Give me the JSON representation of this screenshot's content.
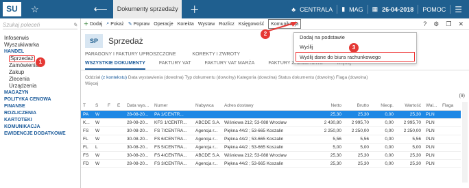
{
  "topbar": {
    "logo": "SU",
    "tab_title": "Dokumenty sprzedaży",
    "centrala": "CENTRALA",
    "mag": "MAG",
    "date": "26-04-2018",
    "pomoc": "POMOC"
  },
  "sidebar": {
    "search_placeholder": "Szukaj poleceń",
    "items": [
      {
        "label": "Infoserwis",
        "kind": "item"
      },
      {
        "label": "Wyszukiwarka",
        "kind": "item"
      },
      {
        "label": "HANDEL",
        "kind": "head"
      },
      {
        "label": "Sprzedaż",
        "kind": "active"
      },
      {
        "label": "Zamówienia",
        "kind": "sub"
      },
      {
        "label": "Zakup",
        "kind": "sub"
      },
      {
        "label": "Zlecenia",
        "kind": "sub"
      },
      {
        "label": "Urządzenia",
        "kind": "sub"
      },
      {
        "label": "MAGAZYN",
        "kind": "head"
      },
      {
        "label": "POLITYKA CENOWA",
        "kind": "head"
      },
      {
        "label": "FINANSE",
        "kind": "head"
      },
      {
        "label": "ROZLICZENIA",
        "kind": "head"
      },
      {
        "label": "KARTOTEKI",
        "kind": "head"
      },
      {
        "label": "KOMUNIKACJA",
        "kind": "head"
      },
      {
        "label": "EWIDENCJE DODATKOWE",
        "kind": "head"
      }
    ]
  },
  "toolbar": {
    "dodaj": "Dodaj",
    "pokaz": "Pokaż",
    "popraw": "Popraw",
    "operacje": "Operacje",
    "korekta": "Korekta",
    "wystaw": "Wystaw",
    "rozlicz": "Rozlicz",
    "ksiegowosc": "Księgowość",
    "komunikacja": "Komunikacja"
  },
  "page": {
    "badge": "SP",
    "title": "Sprzedaż"
  },
  "tabs_row1": [
    "PARAGONY I FAKTURY UPROSZCZONE",
    "KOREKTY I ZWROTY"
  ],
  "tabs_row2": [
    "WSZYSTKIE DOKUMENTY",
    "FAKTURY VAT",
    "FAKTURY VAT MARŻA",
    "FAKTURY ZALICZKOWE",
    "Więcej"
  ],
  "filters": {
    "oddzial": "Oddział",
    "oddzial_val": "(z kontekstu)",
    "rest": "Data wystawienia (dowolna)   Typ dokumentu (dowolny)   Kategoria (dowolna)   Status dokumentu (dowolny)   Flaga (dowolna)",
    "wiecej": "Więcej",
    "count": "(9)"
  },
  "table": {
    "headers": [
      "T",
      "S",
      "F",
      "E",
      "Data wys...",
      "Numer",
      "Nabywca",
      "Adres dostawy",
      "Netto",
      "Brutto",
      "Nieop.",
      "Wartość",
      "Wal...",
      "Flaga"
    ],
    "rows": [
      [
        "PA",
        "W",
        "",
        "",
        "28-08-20...",
        "PA 1/CENTR...",
        "",
        "",
        "25,30",
        "25,30",
        "0,00",
        "25,30",
        "PLN",
        ""
      ],
      [
        "K...",
        "W",
        "",
        "",
        "28-08-20...",
        "KFS 1/CENTR...",
        "ABCDE S.A.",
        "Wiśniowa 212; 53-088 Wrocław",
        "2 430,80",
        "2 995,70",
        "0,00",
        "2 995,70",
        "PLN",
        ""
      ],
      [
        "FS",
        "W",
        "",
        "",
        "30-08-20...",
        "FS 7/CENTRA...",
        "Agencja r...",
        "Piękna  44/2 ; 53-665 Koszalin",
        "2 250,00",
        "2 250,00",
        "0,00",
        "2 250,00",
        "PLN",
        ""
      ],
      [
        "FL",
        "W",
        "",
        "",
        "30-08-20...",
        "FS 6/CENTRA...",
        "Agencja r...",
        "Piękna  44/2 ; 53-665 Koszalin",
        "5,56",
        "5,56",
        "0,00",
        "5,56",
        "PLN",
        ""
      ],
      [
        "FL",
        "L",
        "",
        "",
        "30-08-20...",
        "FS 5/CENTRA...",
        "Agencja r...",
        "Piękna  44/2 ; 53-665 Koszalin",
        "5,00",
        "5,00",
        "0,00",
        "5,00",
        "PLN",
        ""
      ],
      [
        "FS",
        "W",
        "",
        "",
        "30-08-20...",
        "FS 4/CENTRA...",
        "ABCDE S.A.",
        "Wiśniowa 212; 53-088 Wrocław",
        "25,30",
        "25,30",
        "0,00",
        "25,30",
        "PLN",
        ""
      ],
      [
        "FD",
        "W",
        "",
        "",
        "28-08-20...",
        "FS 3/CENTRA...",
        "Agencja r...",
        "Piękna  44/2 ; 53-665 Koszalin",
        "25,30",
        "25,30",
        "0,00",
        "25,30",
        "PLN",
        ""
      ]
    ]
  },
  "dropdown": {
    "items": [
      "Dodaj na podstawie",
      "Wyślij",
      "Wyślij dane do biura rachunkowego"
    ]
  },
  "markers": [
    "1",
    "2",
    "3"
  ]
}
